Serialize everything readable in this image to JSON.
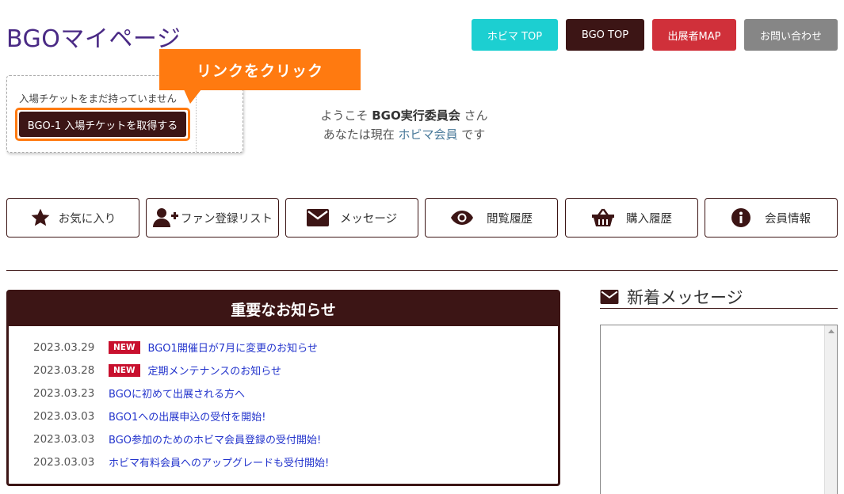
{
  "page": {
    "title": "BGOマイページ"
  },
  "top_nav": {
    "hobima_top": "ホビマ TOP",
    "bgo_top": "BGO TOP",
    "exhibitor_map": "出展者MAP",
    "contact": "お問い合わせ"
  },
  "ticket": {
    "note": "入場チケットをまだ持っていません",
    "button": "BGO-1 入場チケットを取得する"
  },
  "callout": {
    "text": "リンクをクリック"
  },
  "welcome": {
    "line1_prefix": "ようこそ ",
    "user_name": "BGO実行委員会",
    "line1_suffix": " さん",
    "line2_prefix": "あなたは現在 ",
    "member_type": "ホビマ会員",
    "line2_suffix": " です"
  },
  "nav": [
    {
      "label": "お気に入り",
      "icon": "star-icon"
    },
    {
      "label": "ファン登録リスト",
      "icon": "user-plus-icon"
    },
    {
      "label": "メッセージ",
      "icon": "envelope-icon"
    },
    {
      "label": "閲覧履歴",
      "icon": "eye-icon"
    },
    {
      "label": "購入履歴",
      "icon": "basket-icon"
    },
    {
      "label": "会員情報",
      "icon": "info-icon"
    }
  ],
  "notices": {
    "title": "重要なお知らせ",
    "items": [
      {
        "date": "2023.03.29",
        "badge": "NEW",
        "text": "BGO1開催日が7月に変更のお知らせ"
      },
      {
        "date": "2023.03.28",
        "badge": "NEW",
        "text": "定期メンテナンスのお知らせ"
      },
      {
        "date": "2023.03.23",
        "badge": "",
        "text": "BGOに初めて出展される方へ"
      },
      {
        "date": "2023.03.03",
        "badge": "",
        "text": "BGO1への出展申込の受付を開始!"
      },
      {
        "date": "2023.03.03",
        "badge": "",
        "text": "BGO参加のためのホビマ会員登録の受付開始!"
      },
      {
        "date": "2023.03.03",
        "badge": "",
        "text": "ホビマ有料会員へのアップグレードも受付開始!"
      }
    ]
  },
  "messages": {
    "title": "新着メッセージ"
  },
  "colors": {
    "title_purple": "#4a2a85",
    "dark_brown": "#3c1515",
    "cyan": "#1ccfd1",
    "red": "#d0303a",
    "gray": "#868686",
    "orange": "#ff7a10",
    "badge_red": "#c8102e",
    "link_blue": "#2233cc"
  }
}
